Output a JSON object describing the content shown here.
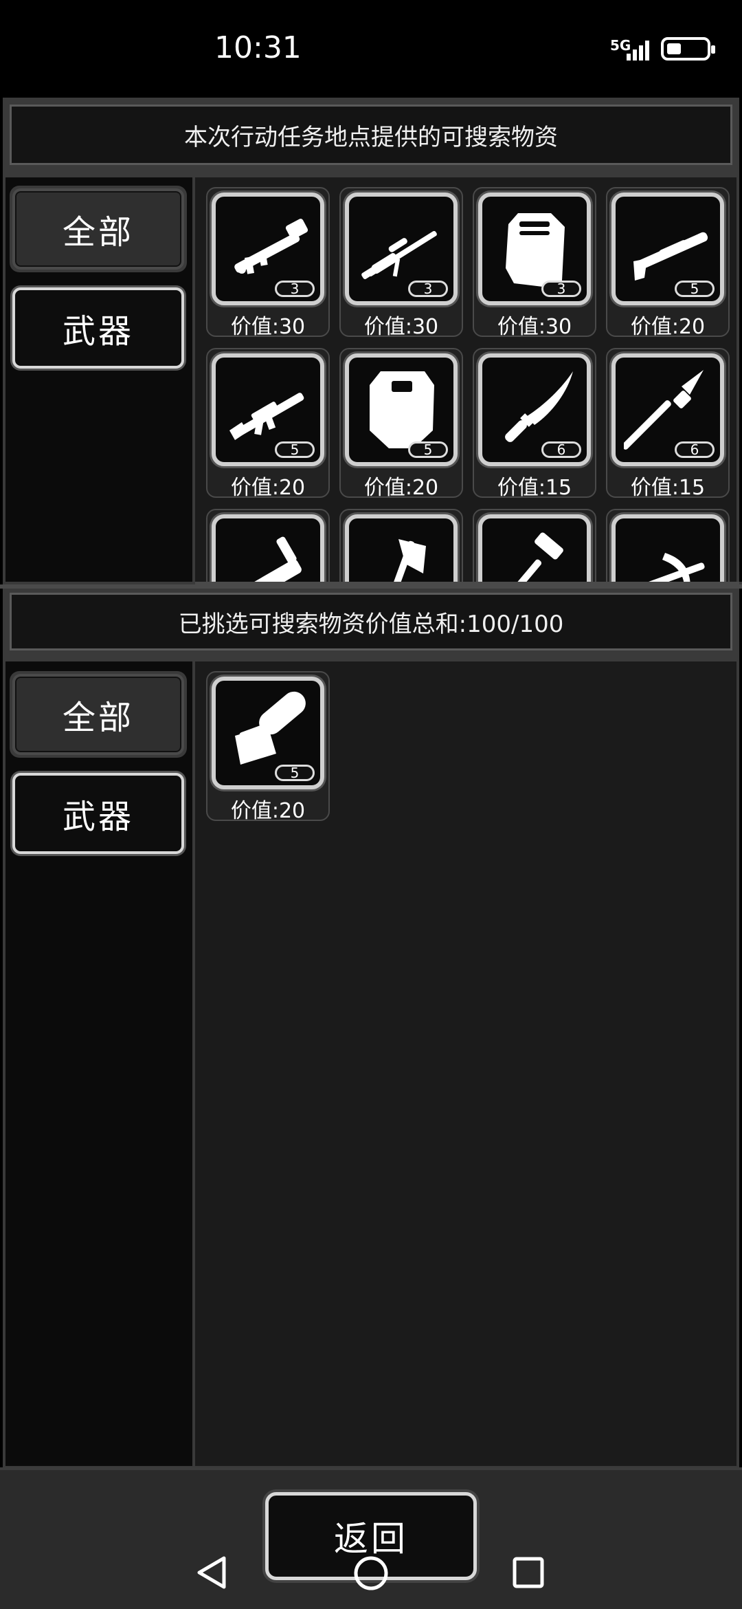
{
  "status": {
    "time": "10:31",
    "network": "5G"
  },
  "top_panel": {
    "title": "本次行动任务地点提供的可搜索物资",
    "tabs": [
      "全部",
      "武器"
    ],
    "items": [
      {
        "icon": "rocket-launcher-icon",
        "qty": "3",
        "price": "价值:30"
      },
      {
        "icon": "sniper-rifle-icon",
        "qty": "3",
        "price": "价值:30"
      },
      {
        "icon": "armor-vest-icon",
        "qty": "3",
        "price": "价值:30"
      },
      {
        "icon": "shotgun-icon",
        "qty": "5",
        "price": "价值:20"
      },
      {
        "icon": "assault-rifle-icon",
        "qty": "5",
        "price": "价值:20"
      },
      {
        "icon": "riot-shield-icon",
        "qty": "5",
        "price": "价值:20"
      },
      {
        "icon": "combat-knife-icon",
        "qty": "6",
        "price": "价值:15"
      },
      {
        "icon": "spear-icon",
        "qty": "6",
        "price": "价值:15"
      },
      {
        "icon": "sword-icon"
      },
      {
        "icon": "axe-icon"
      },
      {
        "icon": "hammer-icon"
      },
      {
        "icon": "crossbow-icon"
      }
    ]
  },
  "bottom_panel": {
    "title": "已挑选可搜索物资价值总和:100/100",
    "tabs": [
      "全部",
      "武器"
    ],
    "items": [
      {
        "icon": "chainsaw-icon",
        "qty": "5",
        "price": "价值:20"
      }
    ]
  },
  "footer": {
    "back_label": "返回"
  }
}
